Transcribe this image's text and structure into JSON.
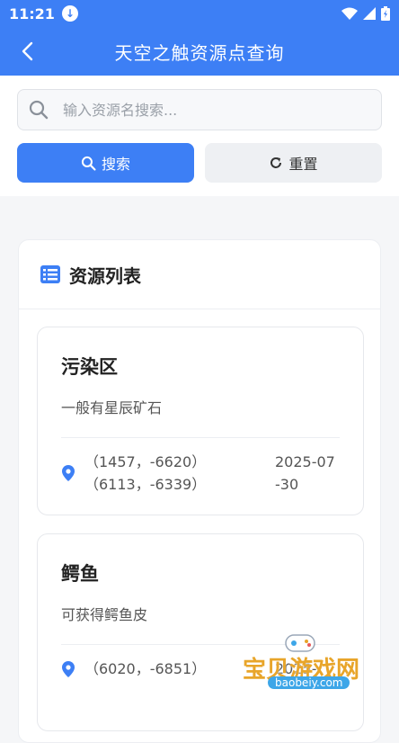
{
  "status_bar": {
    "time": "11:21"
  },
  "app_bar": {
    "title": "天空之触资源点查询"
  },
  "search": {
    "placeholder": "输入资源名搜索...",
    "search_label": "搜索",
    "reset_label": "重置"
  },
  "list": {
    "title": "资源列表",
    "items": [
      {
        "name": "污染区",
        "description": "一般有星辰矿石",
        "coords": [
          "（1457，-6620）",
          "（6113，-6339）"
        ],
        "date": "2025-07-30"
      },
      {
        "name": "鳄鱼",
        "description": "可获得鳄鱼皮",
        "coords": [
          "（6020，-6851）"
        ],
        "date": "2025-"
      }
    ]
  },
  "watermark": {
    "text": "宝贝游戏网",
    "url": "baobeiy.com"
  },
  "colors": {
    "accent": "#3d7ff5"
  }
}
